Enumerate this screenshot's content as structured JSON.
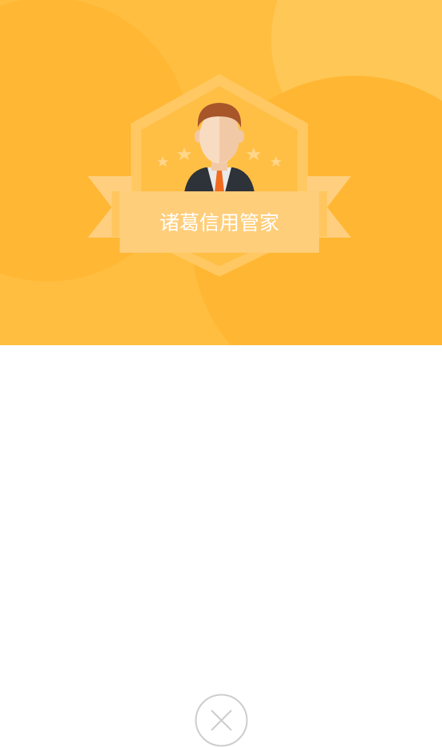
{
  "banner": {
    "title": "诸葛信用管家",
    "icon": "avatar-badge-icon"
  },
  "colors": {
    "background": "#FFBC3C",
    "accent": "#FFCF76",
    "badge": "#FFD07A",
    "close_circle": "#CDCDCD"
  },
  "close_button": {
    "icon": "close-icon"
  }
}
